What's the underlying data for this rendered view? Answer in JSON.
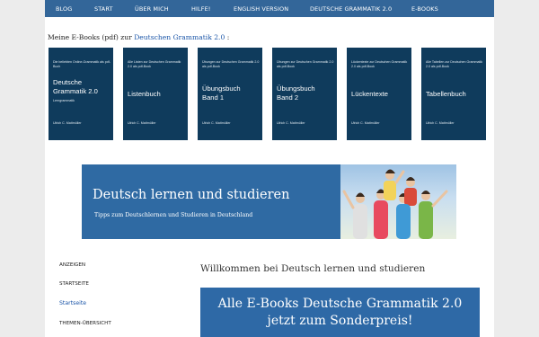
{
  "nav": {
    "items": [
      "BLOG",
      "START",
      "ÜBER MICH",
      "HILFE!",
      "ENGLISH VERSION",
      "DEUTSCHE GRAMMATIK 2.0",
      "E-BOOKS"
    ]
  },
  "intro": {
    "text": "Meine E-Books (pdf) zur ",
    "link": "Deutschen Grammatik 2.0",
    "suffix": " :"
  },
  "books": [
    {
      "subtitle": "Die beliebten Online-Grammatik als pdf-Buch",
      "title_line1": "Deutsche",
      "title_line2": "Grammatik 2.0",
      "extra": "Lerngrammatik",
      "author": "Ulrich C. Mattmüller"
    },
    {
      "subtitle": "Alle Listen zur Deutschen Grammatik 2.0 als pdf-Book",
      "title_line1": "Listenbuch",
      "title_line2": "",
      "extra": "",
      "author": "Ulrich C. Mattmüller"
    },
    {
      "subtitle": "Übungen zur Deutschen Grammatik 2.0 als pdf-Book",
      "title_line1": "Übungsbuch",
      "title_line2": "Band 1",
      "extra": "",
      "author": "Ulrich C. Mattmüller"
    },
    {
      "subtitle": "Übungen zur Deutschen Grammatik 2.0 als pdf-Book",
      "title_line1": "Übungsbuch",
      "title_line2": "Band 2",
      "extra": "",
      "author": "Ulrich C. Mattmüller"
    },
    {
      "subtitle": "Lückentexte zur Deutschen Grammatik 2.0 als pdf-Book",
      "title_line1": "Lückentexte",
      "title_line2": "",
      "extra": "",
      "author": "Ulrich C. Mattmüller"
    },
    {
      "subtitle": "Alle Tabellen zur Deutschen Grammatik 2.0 als pdf-Book",
      "title_line1": "Tabellenbuch",
      "title_line2": "",
      "extra": "",
      "author": "Ulrich C. Mattmüller"
    }
  ],
  "banner": {
    "title": "Deutsch lernen und studieren",
    "subtitle": "Tipps zum Deutschlernen und Studieren in Deutschland"
  },
  "sidebar": {
    "items": [
      "ANZEIGEN",
      "STARTSEITE",
      "Startseite",
      "THEMEN-ÜBERSICHT"
    ]
  },
  "main": {
    "welcome": "Willkommen bei Deutsch lernen und studieren",
    "promo_line1": "Alle E-Books Deutsche Grammatik 2.0",
    "promo_line2": "jetzt zum Sonderpreis!"
  },
  "colors": {
    "nav": "#336699",
    "book": "#0f3b5c",
    "banner": "#2f6aa3",
    "link": "#1a55a8"
  }
}
